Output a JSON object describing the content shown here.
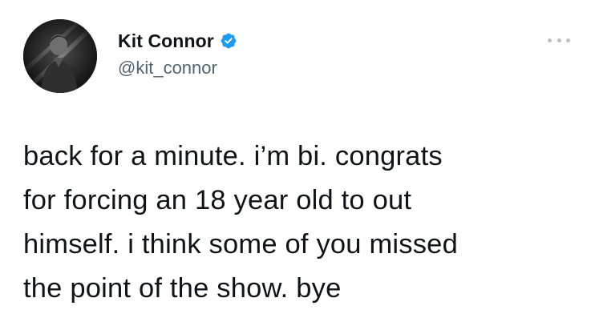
{
  "author": {
    "display_name": "Kit Connor",
    "handle": "@kit_connor",
    "verified": true,
    "verified_icon": "verified-badge-icon",
    "avatar": "profile-photo"
  },
  "menu": {
    "icon": "more-options-icon"
  },
  "tweet": {
    "text": "back for a minute. i’m bi. congrats\nfor forcing an 18 year old to out\nhimself. i think some of you missed\nthe point of the show. bye"
  },
  "colors": {
    "text_primary": "#0f1419",
    "text_secondary": "#536471",
    "verified_blue": "#1d9bf0",
    "more_icon": "#b9c2c9"
  }
}
